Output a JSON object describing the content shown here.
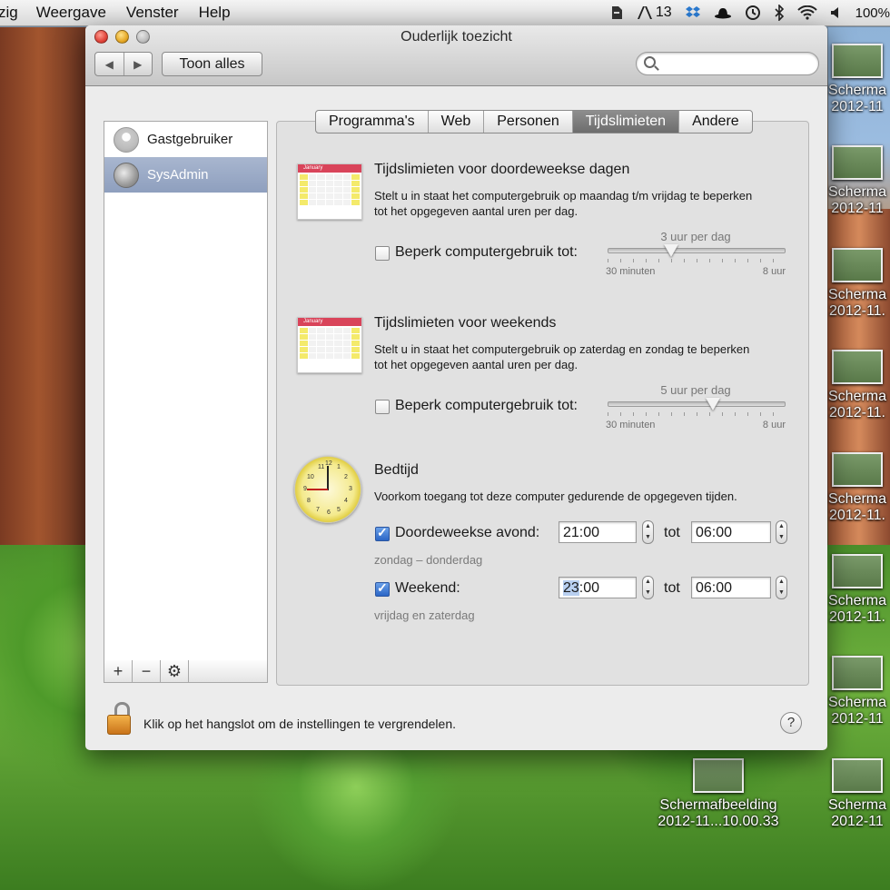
{
  "menubar": {
    "items": [
      "zig",
      "Weergave",
      "Venster",
      "Help"
    ],
    "status": {
      "badge_count": "13",
      "battery": "100%"
    }
  },
  "window": {
    "title": "Ouderlijk toezicht",
    "show_all": "Toon alles",
    "search_placeholder": ""
  },
  "users": [
    {
      "name": "Gastgebruiker",
      "selected": false
    },
    {
      "name": "SysAdmin",
      "selected": true
    }
  ],
  "listbar": {
    "add": "+",
    "remove": "−",
    "gear": "⚙"
  },
  "tabs": [
    {
      "label": "Programma's",
      "active": false
    },
    {
      "label": "Web",
      "active": false
    },
    {
      "label": "Personen",
      "active": false
    },
    {
      "label": "Tijdslimieten",
      "active": true
    },
    {
      "label": "Andere",
      "active": false
    }
  ],
  "weekdays": {
    "calendar_month": "January",
    "title": "Tijdslimieten voor doordeweekse dagen",
    "description": "Stelt u in staat het computergebruik op maandag t/m vrijdag te beperken tot het opgegeven aantal uren per dag.",
    "checkbox_label": "Beperk computergebruik tot:",
    "checked": false,
    "slider_value": "3 uur per dag",
    "slider_fraction": 0.36,
    "slider_min": "30 minuten",
    "slider_max": "8 uur"
  },
  "weekends": {
    "calendar_month": "January",
    "title": "Tijdslimieten voor weekends",
    "description": "Stelt u in staat het computergebruik op zaterdag en zondag te beperken tot het opgegeven aantal uren per dag.",
    "checkbox_label": "Beperk computergebruik tot:",
    "checked": false,
    "slider_value": "5 uur per dag",
    "slider_fraction": 0.6,
    "slider_min": "30 minuten",
    "slider_max": "8 uur"
  },
  "bedtime": {
    "title": "Bedtijd",
    "description": "Voorkom toegang tot deze computer gedurende de opgegeven tijden.",
    "clock_numbers": [
      "11",
      "12",
      "1",
      "10",
      "2",
      "9",
      "3",
      "8",
      "4",
      "7",
      "5",
      "6"
    ],
    "weekday": {
      "label": "Doordeweekse avond:",
      "checked": true,
      "from": "21:00",
      "to_label": "tot",
      "to": "06:00",
      "sublabel": "zondag – donderdag"
    },
    "weekend": {
      "label": "Weekend:",
      "checked": true,
      "from_hour": "23",
      "from_rest": ":00",
      "to_label": "tot",
      "to": "06:00",
      "sublabel": "vrijdag en zaterdag"
    }
  },
  "footer": {
    "lock_text": "Klik op het hangslot om de instellingen te vergrendelen.",
    "help": "?"
  },
  "desktop_icons": [
    {
      "line1": "Scherma",
      "line2": "2012-11"
    },
    {
      "line1": "Scherma",
      "line2": "2012-11"
    },
    {
      "line1": "Scherma",
      "line2": "2012-11."
    },
    {
      "line1": "Scherma",
      "line2": "2012-11."
    },
    {
      "line1": "Scherma",
      "line2": "2012-11."
    },
    {
      "line1": "Scherma",
      "line2": "2012-11."
    },
    {
      "line1": "Scherma",
      "line2": "2012-11"
    },
    {
      "line1": "Scherma",
      "line2": "2012-11"
    },
    {
      "line1": "Schermafbeelding",
      "line2": "2012-11...10.00.33"
    }
  ]
}
